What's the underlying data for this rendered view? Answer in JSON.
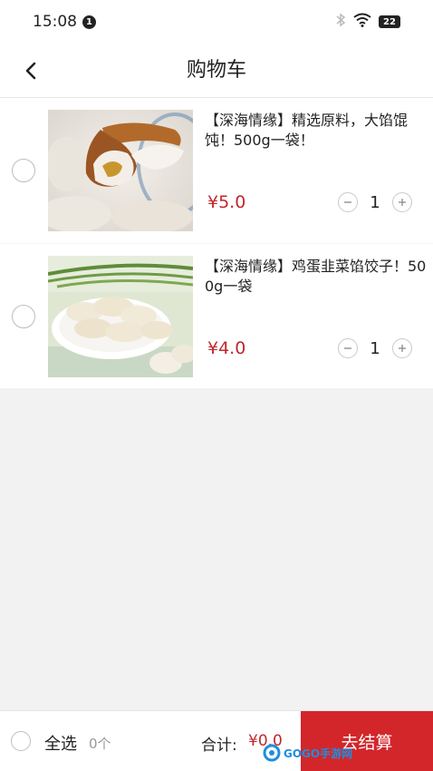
{
  "status_bar": {
    "time": "15:08",
    "notification_count": "1",
    "battery": "22",
    "icons": [
      "bluetooth-icon",
      "wifi-icon",
      "battery-icon"
    ]
  },
  "nav": {
    "title": "购物车",
    "back_icon": "chevron-left-icon"
  },
  "cart": {
    "items": [
      {
        "name": "【深海情缘】精选原料，大馅馄饨！500g一袋！",
        "price": "¥5.0",
        "quantity": "1",
        "image": "wonton-on-spoon"
      },
      {
        "name": "【深海情缘】鸡蛋韭菜馅饺子！500g一袋",
        "price": "¥4.0",
        "quantity": "1",
        "image": "dumplings-plate"
      }
    ]
  },
  "footer": {
    "select_all_label": "全选",
    "selected_count": "0个",
    "total_label": "合计:",
    "total_amount": "¥0.0",
    "checkout_label": "去结算"
  },
  "watermark": {
    "text": "GOGO手游网"
  },
  "colors": {
    "accent": "#d3262b",
    "price": "#c1272d",
    "background": "#f2f2f2"
  }
}
